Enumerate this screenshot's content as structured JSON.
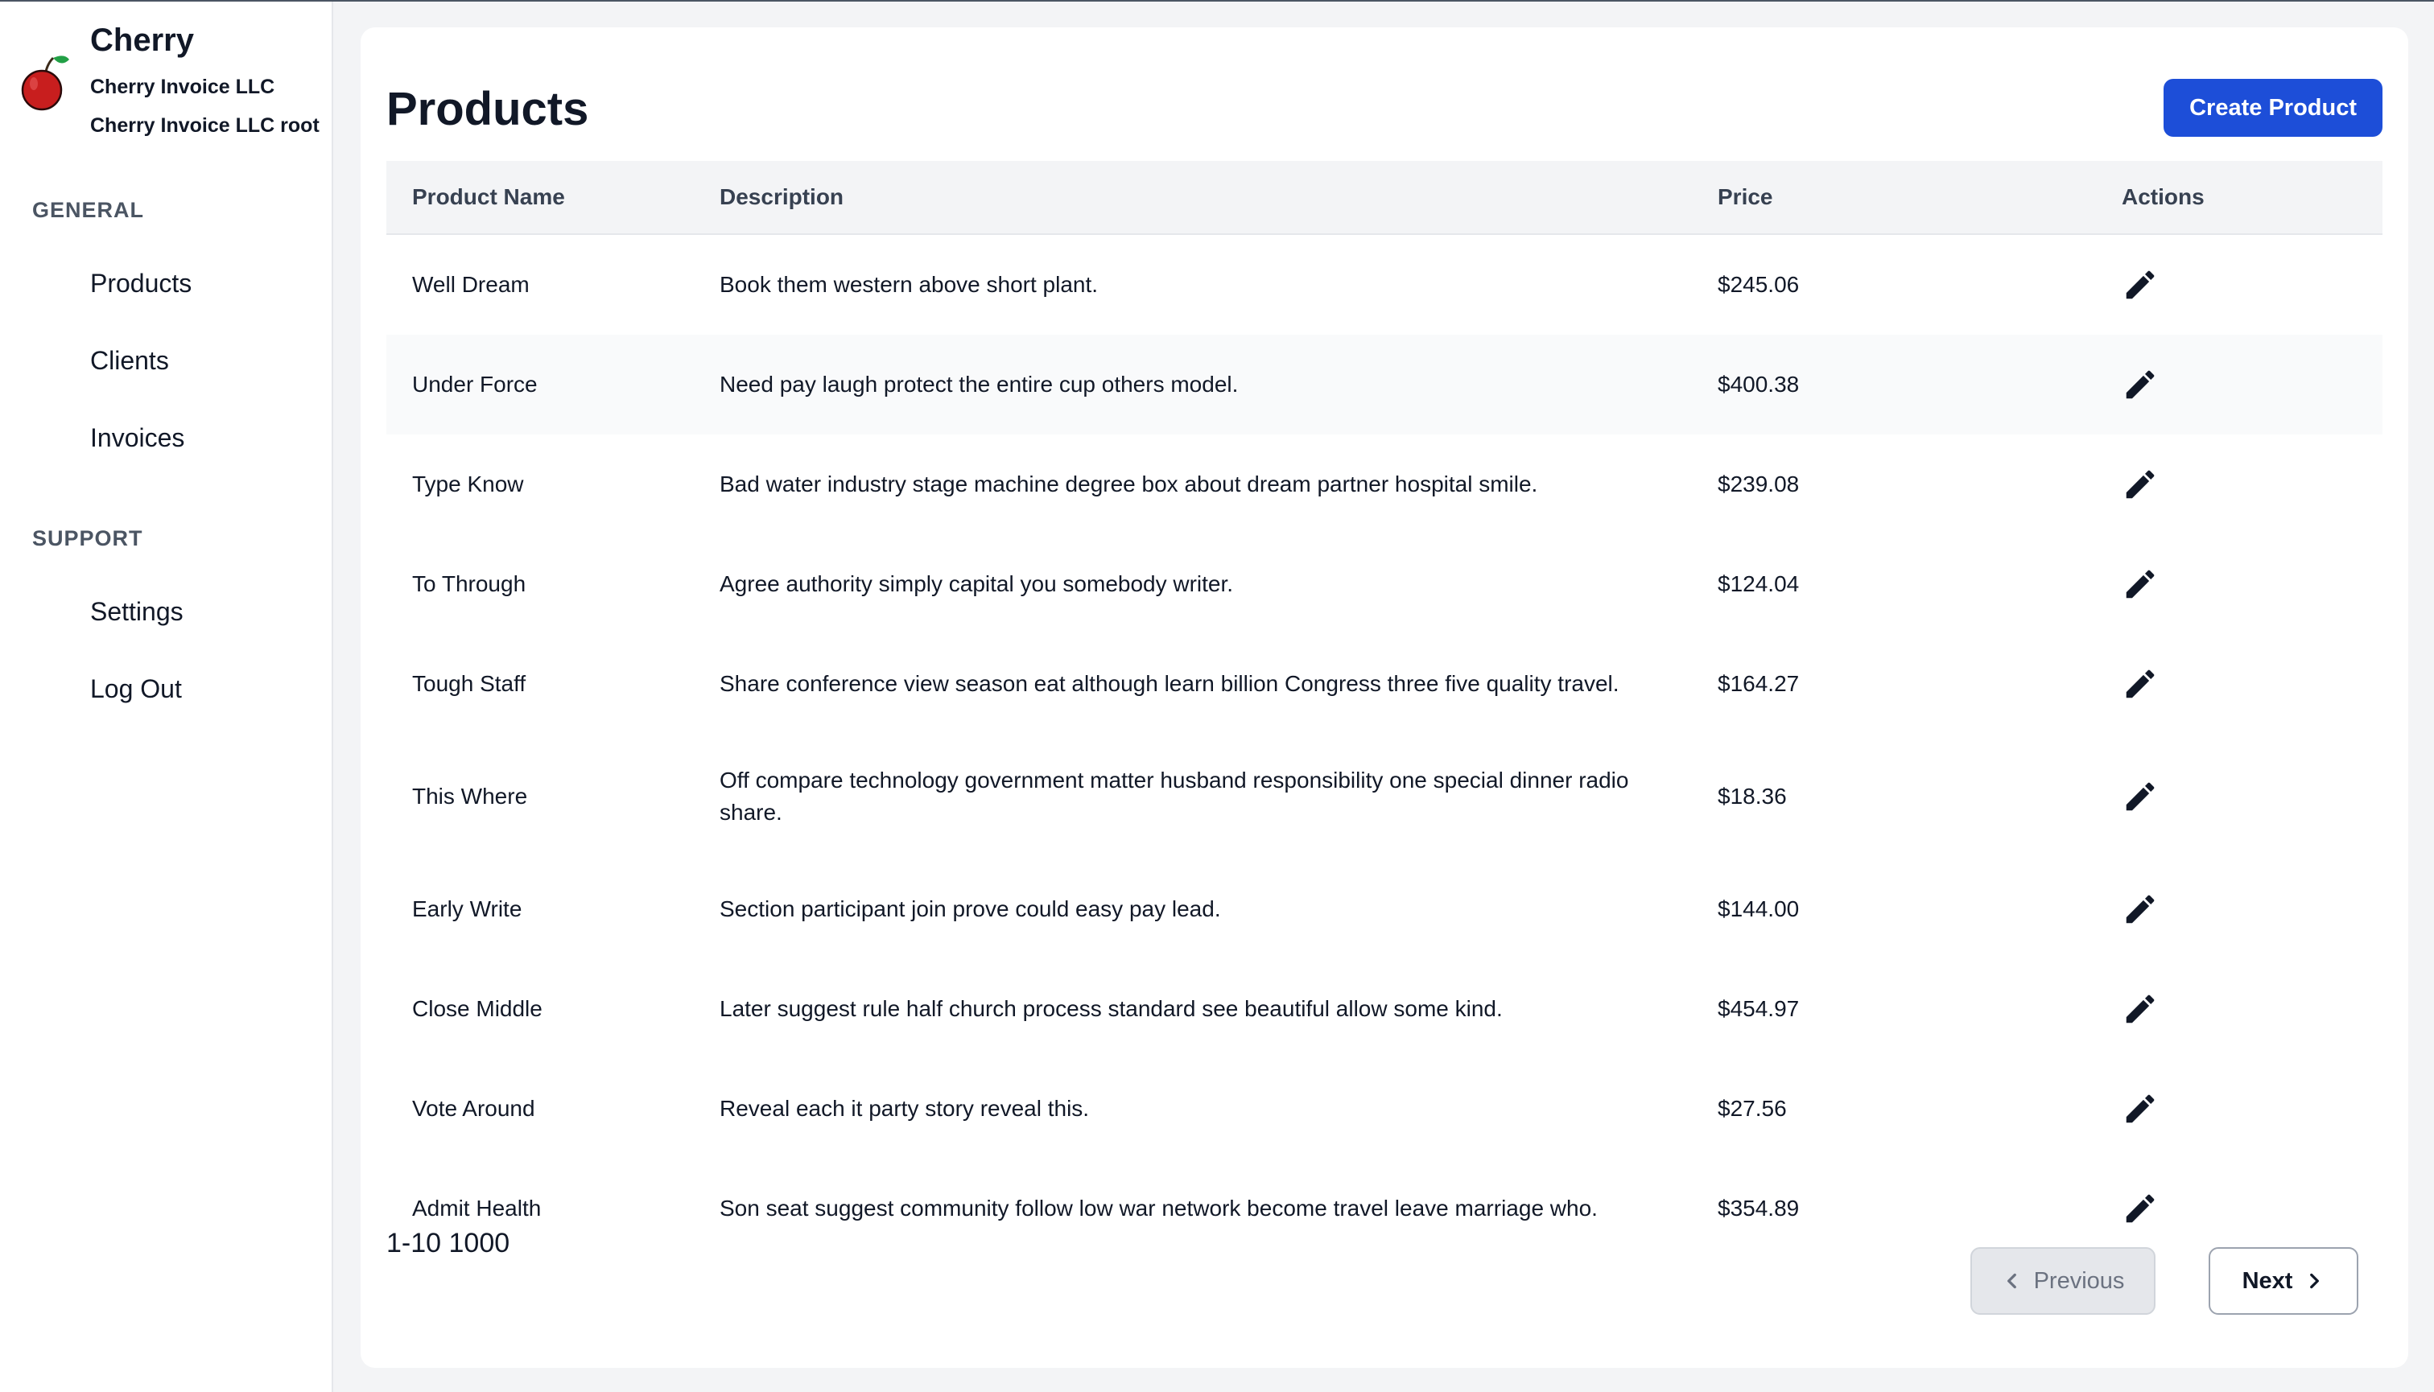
{
  "brand": {
    "name": "Cherry",
    "company": "Cherry Invoice LLC",
    "user": "Cherry Invoice LLC root",
    "logo_icon": "cherry-icon"
  },
  "sidebar": {
    "sections": [
      {
        "heading": "GENERAL",
        "items": [
          {
            "label": "Products"
          },
          {
            "label": "Clients"
          },
          {
            "label": "Invoices"
          }
        ]
      },
      {
        "heading": "SUPPORT",
        "items": [
          {
            "label": "Settings"
          },
          {
            "label": "Log Out"
          }
        ]
      }
    ]
  },
  "page": {
    "title": "Products",
    "create_label": "Create Product"
  },
  "table": {
    "headers": {
      "name": "Product Name",
      "description": "Description",
      "price": "Price",
      "actions": "Actions"
    },
    "action_icon": "pencil-icon",
    "rows": [
      {
        "name": "Well Dream",
        "description": "Book them western above short plant.",
        "price": "$245.06"
      },
      {
        "name": "Under Force",
        "description": "Need pay laugh protect the entire cup others model.",
        "price": "$400.38"
      },
      {
        "name": "Type Know",
        "description": "Bad water industry stage machine degree box about dream partner hospital smile.",
        "price": "$239.08"
      },
      {
        "name": "To Through",
        "description": "Agree authority simply capital you somebody writer.",
        "price": "$124.04"
      },
      {
        "name": "Tough Staff",
        "description": "Share conference view season eat although learn billion Congress three five quality travel.",
        "price": "$164.27"
      },
      {
        "name": "This Where",
        "description": "Off compare technology government matter husband responsibility one special dinner radio share.",
        "price": "$18.36"
      },
      {
        "name": "Early Write",
        "description": "Section participant join prove could easy pay lead.",
        "price": "$144.00"
      },
      {
        "name": "Close Middle",
        "description": "Later suggest rule half church process standard see beautiful allow some kind.",
        "price": "$454.97"
      },
      {
        "name": "Vote Around",
        "description": "Reveal each it party story reveal this.",
        "price": "$27.56"
      },
      {
        "name": "Admit Health",
        "description": "Son seat suggest community follow low war network become travel leave marriage who.",
        "price": "$354.89"
      }
    ]
  },
  "pagination": {
    "range": "1-10",
    "total": "1000",
    "previous_label": "Previous",
    "next_label": "Next",
    "previous_disabled": true
  },
  "colors": {
    "primary": "#1d4ed8",
    "background": "#f3f4f6",
    "card": "#ffffff",
    "text": "#111827",
    "muted": "#4b5563",
    "logo_red": "#c81e1e",
    "logo_green": "#22a046"
  }
}
